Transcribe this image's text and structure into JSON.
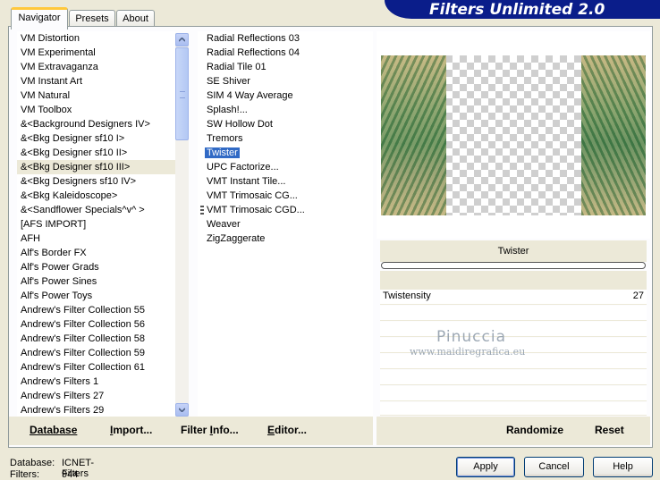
{
  "header": {
    "title": "Filters Unlimited 2.0"
  },
  "tabs": [
    {
      "label": "Navigator",
      "active": true
    },
    {
      "label": "Presets",
      "active": false
    },
    {
      "label": "About",
      "active": false
    }
  ],
  "categories": {
    "items": [
      "VM Distortion",
      "VM Experimental",
      "VM Extravaganza",
      "VM Instant Art",
      "VM Natural",
      "VM Toolbox",
      "&<Background Designers IV>",
      "&<Bkg Designer sf10 I>",
      "&<Bkg Designer sf10 II>",
      "&<Bkg Designer sf10 III>",
      "&<Bkg Designers sf10 IV>",
      "&<Bkg Kaleidoscope>",
      "&<Sandflower Specials^v^ >",
      "[AFS IMPORT]",
      "AFH",
      "Alf's Border FX",
      "Alf's Power Grads",
      "Alf's Power Sines",
      "Alf's Power Toys",
      "Andrew's Filter Collection 55",
      "Andrew's Filter Collection 56",
      "Andrew's Filter Collection 58",
      "Andrew's Filter Collection 59",
      "Andrew's Filter Collection 61",
      "Andrew's Filters 1",
      "Andrew's Filters 27",
      "Andrew's Filters 29"
    ],
    "selected_index": 9
  },
  "filters": {
    "items": [
      "Radial Reflections 03",
      "Radial Reflections 04",
      "Radial Tile 01",
      "SE Shiver",
      "SIM 4 Way Average",
      "Splash!...",
      "SW Hollow Dot",
      "Tremors",
      "Twister",
      "UPC Factorize...",
      "VMT Instant Tile...",
      "VMT Trimosaic CG...",
      "VMT Trimosaic CGD...",
      "Weaver",
      "ZigZaggerate"
    ],
    "selected_index": 8,
    "marked_index": 12
  },
  "filter_panel": {
    "name": "Twister",
    "params": [
      {
        "name": "Twistensity",
        "value": "27"
      }
    ],
    "slider_level": 0.0
  },
  "watermark": {
    "name": "Pinuccia",
    "url": "www.maidiregrafica.eu"
  },
  "left_buttons": [
    {
      "label": "Database",
      "hotkey": "D"
    },
    {
      "label": "Import...",
      "hotkey": "I"
    },
    {
      "label": "Filter Info...",
      "hotkey": "I"
    },
    {
      "label": "Editor...",
      "hotkey": "E"
    }
  ],
  "right_buttons": {
    "randomize": "Randomize",
    "reset": "Reset"
  },
  "status": {
    "database_label": "Database:",
    "database_value": "ICNET-Filters",
    "filters_label": "Filters:",
    "filters_value": "944"
  },
  "dialog_buttons": {
    "apply": "Apply",
    "cancel": "Cancel",
    "help": "Help"
  },
  "colors": {
    "banner": "#0a1d8a",
    "selection": "#316ac5",
    "tab_highlight": "#ffc83c"
  }
}
